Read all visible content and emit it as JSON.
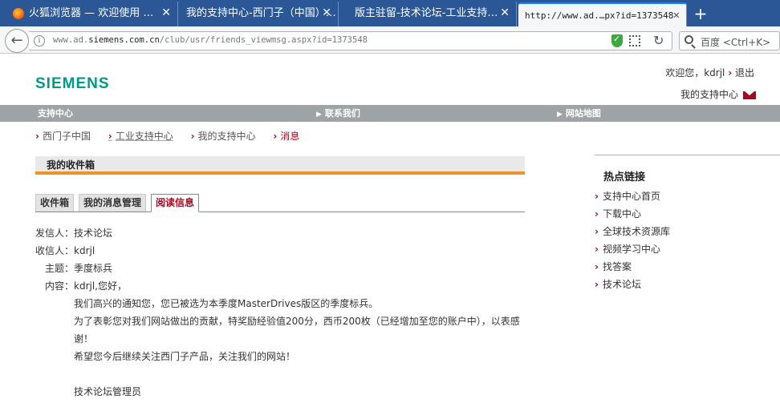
{
  "browser": {
    "tabs": [
      {
        "title": "火狐浏览器 — 欢迎使用 …",
        "close": "✕"
      },
      {
        "title": "我的支持中心-西门子（中国）…",
        "close": "✕"
      },
      {
        "title": "版主驻留-技术论坛-工业支持…",
        "close": "✕"
      },
      {
        "title": "http://www.ad.…px?id=1373548",
        "close": "✕"
      }
    ],
    "new_tab": "+",
    "url_prefix": "www.ad.",
    "url_domain": "siemens.com.cn",
    "url_path": "/club/usr/friends_viewmsg.aspx?id=1373548",
    "search_placeholder": "百度 <Ctrl+K>",
    "back": "←",
    "reload": "↻",
    "info": "i"
  },
  "header": {
    "logo": "SIEMENS",
    "welcome": "欢迎您，kdrjl",
    "logout": "退出",
    "my_support": "我的支持中心"
  },
  "menu": {
    "items": [
      "支持中心",
      "联系我们",
      "网站地图"
    ],
    "tri": "▶"
  },
  "breadcrumb": {
    "chev": "›",
    "items": [
      "西门子中国",
      "工业支持中心",
      "我的支持中心",
      "消息"
    ]
  },
  "inbox": {
    "title": "我的收件箱",
    "tabs": [
      "收件箱",
      "我的消息管理",
      "阅读信息"
    ]
  },
  "message": {
    "sender_label": "发信人：",
    "sender": "技术论坛",
    "recipient_label": "收信人：",
    "recipient": "kdrjl",
    "subject_label": "主题：",
    "subject": "季度标兵",
    "content_label": "内容：",
    "greeting": "kdrjl,您好，",
    "lines": [
      "我们高兴的通知您，您已被选为本季度MasterDrives版区的季度标兵。",
      "为了表彰您对我们网站做出的贡献，特奖励经验值200分，西币200枚（已经增加至您的账户中），以表感谢！",
      "希望您今后继续关注西门子产品，关注我们的网站！"
    ],
    "signature": "技术论坛管理员"
  },
  "sidebar": {
    "title": "热点链接",
    "chev": "›",
    "links": [
      "支持中心首页",
      "下载中心",
      "全球技术资源库",
      "视频学习中心",
      "找答案",
      "技术论坛"
    ]
  }
}
